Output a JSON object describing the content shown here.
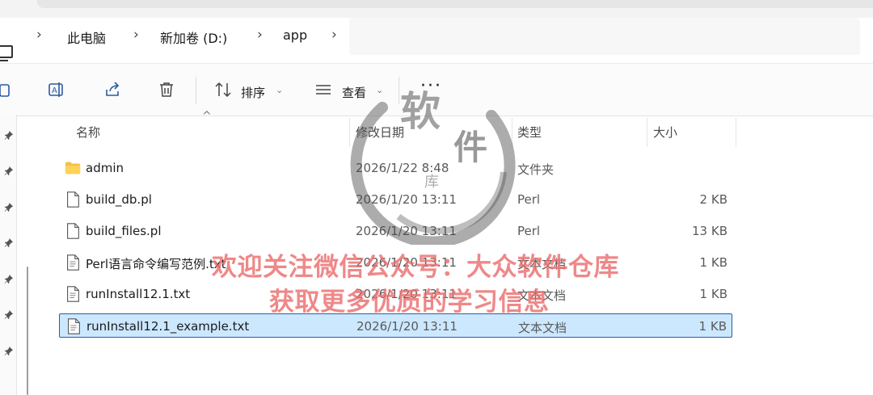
{
  "breadcrumb": {
    "items": [
      "此电脑",
      "新加卷 (D:)",
      "app"
    ]
  },
  "toolbar": {
    "sort_label": "排序",
    "view_label": "查看",
    "more_label": "···"
  },
  "columns": {
    "name": "名称",
    "date": "修改日期",
    "type": "类型",
    "size": "大小"
  },
  "files": [
    {
      "name": "admin",
      "date": "2026/1/22 8:48",
      "type": "文件夹",
      "size": "",
      "icon": "folder-icon"
    },
    {
      "name": "build_db.pl",
      "date": "2026/1/20 13:11",
      "type": "Perl",
      "size": "2 KB",
      "icon": "file-icon"
    },
    {
      "name": "build_files.pl",
      "date": "2026/1/20 13:11",
      "type": "Perl",
      "size": "13 KB",
      "icon": "file-icon"
    },
    {
      "name": "Perl语言命令编写范例.txt",
      "date": "2026/1/20 13:11",
      "type": "文本文档",
      "size": "1 KB",
      "icon": "text-file-icon"
    },
    {
      "name": "runInstall12.1.txt",
      "date": "2026/1/20 13:11",
      "type": "文本文档",
      "size": "1 KB",
      "icon": "text-file-icon"
    },
    {
      "name": "runInstall12.1_example.txt",
      "date": "2026/1/20 13:11",
      "type": "文本文档",
      "size": "1 KB",
      "icon": "text-file-icon",
      "selected": true
    }
  ],
  "watermark": {
    "seal_chars": [
      "软",
      "件",
      "库"
    ],
    "line1": "欢迎关注微信公众号：大众软件仓库",
    "line2": "获取更多优质的学习信息",
    "color": "#ec6e6e"
  }
}
